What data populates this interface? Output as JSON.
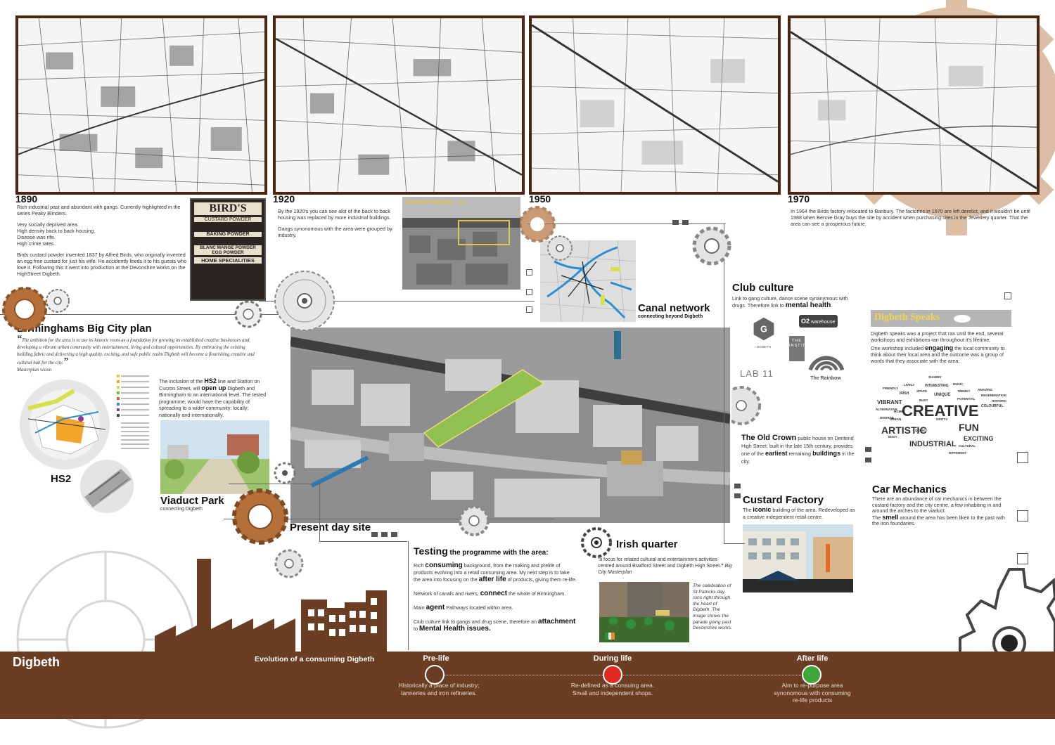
{
  "maps": [
    {
      "year": "1890"
    },
    {
      "year": "1920"
    },
    {
      "year": "1950"
    },
    {
      "year": "1970"
    }
  ],
  "history_1890": {
    "p1": "Rich industrial past and abundant with gangs. Currently highlighted in the series Peaky Blinders.",
    "p2": [
      "Very socially deprived area.",
      "High density back to back housing.",
      "Disease was rife.",
      "High crime rates"
    ],
    "p3": "Birds custard powder invented 1837 by Alfred Birds, who originally invented an egg free custard for just his wife. He accidently feeds it to his guests who love it. Following this it went into production at the Devonshire works on the HighStreet Digbeth."
  },
  "birds_poster": {
    "brand": "BIRD'S",
    "lines": [
      "CUSTARD POWDER",
      "BAKING POWDER",
      "BLANC MANGE POWDER",
      "EGG POWDER",
      "HOME SPECIALITIES"
    ]
  },
  "history_1920": {
    "p1": "By the 1920's you can see alot of the back to back housing was replaced by more industrial buildings.",
    "p2": "Gangs synonomous with the area were grouped by industry."
  },
  "custard_photo": {
    "label": "Custard factory",
    "year": "1921"
  },
  "history_1970": {
    "p1": "In 1964 the Birds factory relocated to Banbury. The factories in 1970 are left derelict, and it wouldn't be until 1988 when Bennie Gray buys the site by accident when purchasing sites in the Jewellery quarter. That the area can see a prosperous future."
  },
  "big_city_plan": {
    "title": "Birminghams Big City plan",
    "quote": "The ambition for the area is to use its historic roots as a foundation for growing its established creative businesses and developing a vibrant urban community with entertainment, living and cultural opportunities. By embracing the existing building fabric and delivering a high quality, exciting, and safe public realm Digbeth will become a flourishing creative and cultural hub for the city.",
    "source": "Masterplan vision"
  },
  "hs2": {
    "label": "HS2",
    "text_pre": "The inclusion of the ",
    "text_bold1": "HS2",
    "text_mid": " line and Station on Curzon Street, will ",
    "text_bold2": "open up",
    "text_post": " Digbeth and Birmingham to an international level. The tested programme, would have the capability of spreading to a wider community: locally; nationally and internationally."
  },
  "viaduct_park": {
    "title": "Viaduct Park",
    "subtitle": "connecting Digbeth"
  },
  "canal_network": {
    "title": "Canal network",
    "subtitle": "connecting beyond Digbeth"
  },
  "present_day": {
    "title": "Present day site"
  },
  "club_culture": {
    "title": "Club culture",
    "text": "Link to gang culture, dance scene synanymous with drugs. Therefore link to ",
    "bold": "mental health",
    "logos": [
      "DIGBETH",
      "O2",
      "warehouse",
      "THE INSTITUTE",
      "LAB 11",
      "The Rainbow"
    ]
  },
  "old_crown": {
    "title": "The Old Crown",
    "text1": " public house on Deritend High Street, built in the late 15th century, provides one of the ",
    "bold1": "earliest",
    "text2": " remaining ",
    "bold2": "buildings",
    "text3": " in the city."
  },
  "custard_factory": {
    "title": "Custard Factory",
    "text_pre": "The ",
    "bold": "iconic",
    "text_post": " building of the area. Redeveloped as a creative independent retail centre."
  },
  "digbeth_speaks": {
    "title": "Digbeth Speaks",
    "text1": "Digbeth speaks was a project that ran until the end, several workshops and exhibitions ran throughout it's lifetime.",
    "text2_pre": "One workshop included ",
    "text2_bold": "engaging",
    "text2_post": " the local community to think about their local area and the outcome was a group of words that they associate with the area:",
    "words_big": [
      "CREATIVE",
      "ARTISTIC",
      "FUN",
      "INDUSTRIAL",
      "EXCITING",
      "VIBRANT"
    ],
    "words_small": [
      "SHABBY",
      "INTERESTING",
      "UNIQUE",
      "IRISH",
      "LIVELY",
      "AMAZING",
      "HISTORIC",
      "COLOURFUL",
      "DIVERSE",
      "QUIRKY",
      "CULTURAL",
      "EDGY",
      "FRIENDLY",
      "TRENDY",
      "GRITTY",
      "URBAN",
      "ALTERNATIVE",
      "REGENERATION",
      "DIFFERENT",
      "MUSIC",
      "HOME",
      "BUSY",
      "POTENTIAL",
      "SPACE"
    ]
  },
  "car_mechanics": {
    "title": "Car Mechanics",
    "text1": "There are an abundance of car mechanics in between the custard factory and the city centre, a few inhabiting in and around the arches to the viaduct.",
    "text2_pre": "The ",
    "text2_bold": "smell",
    "text2_post": " around the area has been liken to the past with the iron foundaries."
  },
  "testing": {
    "title": "Testing",
    "title_rest": " the programme with the area:",
    "p1_pre": "Rich ",
    "p1_bold": "consuming",
    "p1_mid": " background, from the making and prelife of products evolving into a retail consuming area. My next step is to take the area into focusing on the ",
    "p1_bold2": "after life",
    "p1_post": " of products, giving them re-life.",
    "p2_pre": "Network of canals and rivers, ",
    "p2_bold": "connect",
    "p2_post": " the whole of Birmingham.",
    "p3_pre": "Main ",
    "p3_bold": "agent",
    "p3_post": " Pathways located within area.",
    "p4_pre": "Club culture link to gangs and drug scene, therefore an ",
    "p4_bold": "attachment",
    "p4_mid": " to ",
    "p4_bold2": "Mental Health issues."
  },
  "irish_quarter": {
    "title": "Irish quarter",
    "quote": "a focus for related cultural and entertainment activities centred around Bradford Street and Digbeth High Street.",
    "source": "Big City Masterplan",
    "caption": "The celebration of St Patricks day runs right through the heart of Digbeth. The image shows the parade going past Devonshire works."
  },
  "banner": {
    "title": "Digbeth",
    "subtitle": "Evolution of a consuming Digbeth",
    "stages": [
      {
        "title": "Pre-life",
        "text": "Historically a place of industry; tanneries and iron refineries.",
        "color": "#ffffff"
      },
      {
        "title": "During life",
        "text": "Re-defined as a consuing area. Small and independent shops.",
        "color": "#e02a1f"
      },
      {
        "title": "After life",
        "text": "Aim to re-purpose area synonomous with consuming re-life products",
        "color": "#3fa63b"
      }
    ]
  },
  "colors": {
    "brown": "#6b3e24",
    "frame": "#4a2512",
    "rust": "#b5703a",
    "gold": "#e6c34a"
  }
}
